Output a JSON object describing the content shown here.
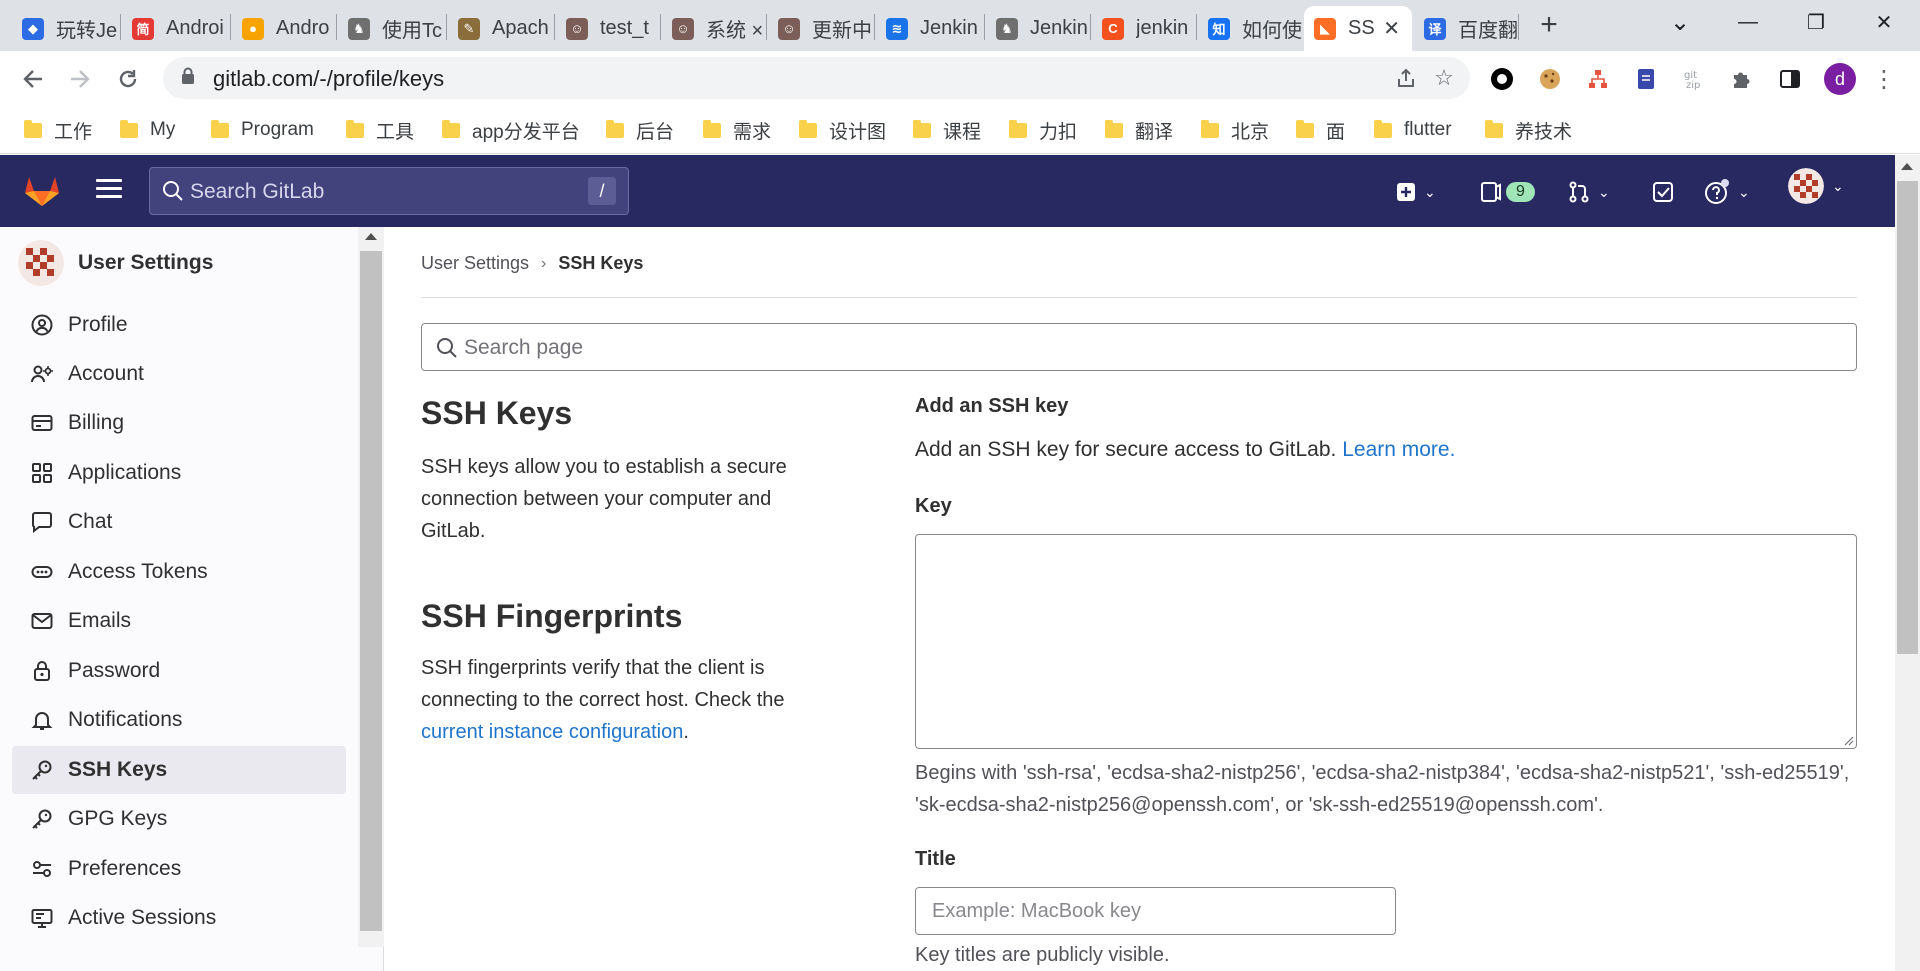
{
  "browser": {
    "tabs": [
      {
        "label": "玩转Je",
        "fav_color": "#2d6be4",
        "fav_glyph": "◆"
      },
      {
        "label": "Androi",
        "fav_color": "#e53935",
        "fav_glyph": "简"
      },
      {
        "label": "Andro",
        "fav_color": "#f7a400",
        "fav_glyph": "●"
      },
      {
        "label": "使用Tc",
        "fav_color": "#6f6f6f",
        "fav_glyph": "♞"
      },
      {
        "label": "Apach",
        "fav_color": "#8a6d3b",
        "fav_glyph": "✎"
      },
      {
        "label": "test_t",
        "fav_color": "#7b5e57",
        "fav_glyph": "☺"
      },
      {
        "label": "系统 ×",
        "fav_color": "#7b5e57",
        "fav_glyph": "☺"
      },
      {
        "label": "更新中",
        "fav_color": "#7b5e57",
        "fav_glyph": "☺"
      },
      {
        "label": "Jenkin",
        "fav_color": "#1a73e8",
        "fav_glyph": "≋"
      },
      {
        "label": "Jenkin",
        "fav_color": "#6f6f6f",
        "fav_glyph": "♞"
      },
      {
        "label": "jenkin",
        "fav_color": "#f4511e",
        "fav_glyph": "C"
      },
      {
        "label": "如何使",
        "fav_color": "#1772f6",
        "fav_glyph": "知"
      },
      {
        "label": "SS",
        "fav_color": "#fc6d26",
        "fav_glyph": "◣"
      },
      {
        "label": "百度翻",
        "fav_color": "#2d6be4",
        "fav_glyph": "译"
      }
    ],
    "active_tab_close": "✕",
    "new_tab": "+",
    "window_controls": {
      "dropdown": "⌄",
      "minimize": "—",
      "restore": "❐",
      "close": "✕"
    },
    "url": "gitlab.com/-/profile/keys",
    "bookmarks": [
      "工作",
      "My",
      "Program",
      "工具",
      "app分发平台",
      "后台",
      "需求",
      "设计图",
      "课程",
      "力扣",
      "翻译",
      "北京",
      "面",
      "flutter",
      "养技术"
    ],
    "profile_initial": "d"
  },
  "gitlab": {
    "search_placeholder": "Search GitLab",
    "search_shortcut": "/",
    "mr_count": "9"
  },
  "sidebar": {
    "title": "User Settings",
    "items": [
      {
        "label": "Profile",
        "icon": "profile-icon"
      },
      {
        "label": "Account",
        "icon": "account-icon"
      },
      {
        "label": "Billing",
        "icon": "billing-icon"
      },
      {
        "label": "Applications",
        "icon": "applications-icon"
      },
      {
        "label": "Chat",
        "icon": "chat-icon"
      },
      {
        "label": "Access Tokens",
        "icon": "token-icon"
      },
      {
        "label": "Emails",
        "icon": "email-icon"
      },
      {
        "label": "Password",
        "icon": "lock-icon"
      },
      {
        "label": "Notifications",
        "icon": "bell-icon"
      },
      {
        "label": "SSH Keys",
        "icon": "key-icon"
      },
      {
        "label": "GPG Keys",
        "icon": "key-icon"
      },
      {
        "label": "Preferences",
        "icon": "preferences-icon"
      },
      {
        "label": "Active Sessions",
        "icon": "monitor-icon"
      }
    ],
    "active_index": 9
  },
  "breadcrumb": {
    "parent": "User Settings",
    "separator": "›",
    "current": "SSH Keys"
  },
  "page_search_placeholder": "Search page",
  "ssh_keys": {
    "title": "SSH Keys",
    "description": "SSH keys allow you to establish a secure connection between your computer and GitLab."
  },
  "ssh_fingerprints": {
    "title": "SSH Fingerprints",
    "description": "SSH fingerprints verify that the client is connecting to the correct host. Check the ",
    "link": "current instance configuration",
    "suffix": "."
  },
  "form": {
    "heading": "Add an SSH key",
    "subtext": "Add an SSH key for secure access to GitLab. ",
    "learn_more": "Learn more.",
    "key_label": "Key",
    "key_help": "Begins with 'ssh-rsa', 'ecdsa-sha2-nistp256', 'ecdsa-sha2-nistp384', 'ecdsa-sha2-nistp521', 'ssh-ed25519', 'sk-ecdsa-sha2-nistp256@openssh.com', or 'sk-ssh-ed25519@openssh.com'.",
    "title_label": "Title",
    "title_placeholder": "Example: MacBook key",
    "title_note": "Key titles are publicly visible."
  }
}
